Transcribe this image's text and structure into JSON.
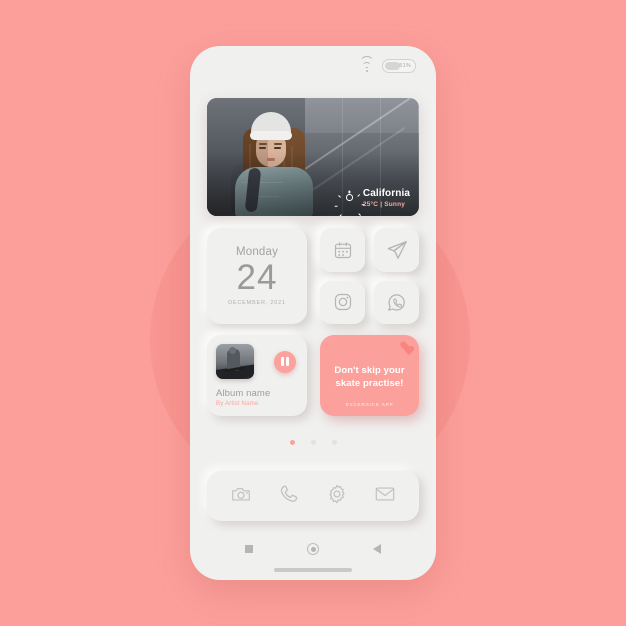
{
  "background": {
    "color": "#fc9f9a",
    "accent_circle": "#f99691"
  },
  "phone": {
    "body_color": "#f0f0ef"
  },
  "status_bar": {
    "wifi_icon": "wifi-icon",
    "battery_icon": "battery-icon",
    "battery_percent": "51%"
  },
  "hero": {
    "photo_alt": "Woman in white beanie and teal jacket with backpack standing by a glass building",
    "weather": {
      "sun_icon": "sun-icon",
      "city": "California",
      "conditions": "25°C  |  Sunny"
    }
  },
  "date_widget": {
    "weekday": "Monday",
    "day": "24",
    "month_year": "DECEMBER, 2021"
  },
  "app_grid": {
    "apps": [
      {
        "name": "calendar",
        "label": "Calendar"
      },
      {
        "name": "telegram",
        "label": "Telegram"
      },
      {
        "name": "instagram",
        "label": "Instagram"
      },
      {
        "name": "whatsapp",
        "label": "WhatsApp"
      }
    ]
  },
  "music_widget": {
    "album_art_alt": "Skateboarder album cover",
    "play_state": "playing",
    "pause_icon": "pause-icon",
    "title": "Album name",
    "artist": "By Artist Name",
    "accent": "#fca29d"
  },
  "promo_card": {
    "heart_icon": "heart-icon",
    "message": "Don't skip your skate practise!",
    "source": "EXCERSICE APP",
    "color": "#fca09b"
  },
  "page_dots": {
    "count": 3,
    "active_index": 0,
    "active_color": "#fba29c"
  },
  "dock": {
    "items": [
      {
        "name": "camera",
        "label": "Camera"
      },
      {
        "name": "phone",
        "label": "Phone"
      },
      {
        "name": "settings",
        "label": "Settings"
      },
      {
        "name": "mail",
        "label": "Mail"
      }
    ]
  },
  "nav_bar": {
    "recents_label": "Recent apps",
    "home_label": "Home",
    "back_label": "Back"
  }
}
